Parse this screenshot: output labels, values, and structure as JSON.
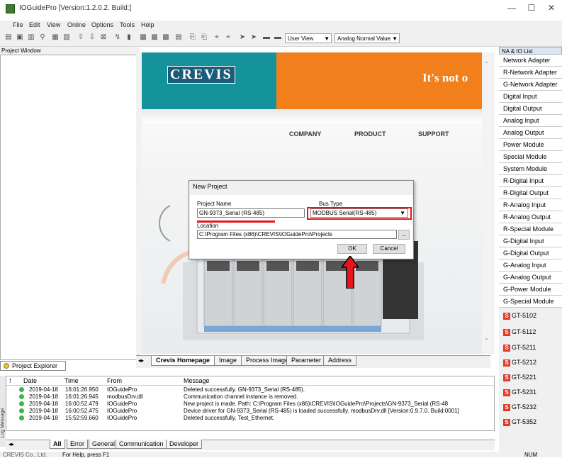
{
  "window": {
    "title": "IOGuidePro  [Version:1.2.0.2. Build:]",
    "minimize": "—",
    "maximize": "☐",
    "close": "✕"
  },
  "menu": [
    "File",
    "Edit",
    "View",
    "Online",
    "Options",
    "Tools",
    "Help"
  ],
  "toolbar": {
    "view_select": "User View",
    "value_select": "Analog Normal Value"
  },
  "project_window": {
    "title": "Project Window",
    "explorer_tab": "Project Explorer"
  },
  "homepage": {
    "logo": "CREVIS",
    "slogan": "It's not o",
    "nav": [
      "COMPANY",
      "PRODUCT",
      "SUPPORT"
    ]
  },
  "view_tabs": [
    "Crevis Homepage",
    "Image",
    "Process Image",
    "Parameter",
    "Address"
  ],
  "right_panel": {
    "title": "NA & IO List",
    "categories": [
      "Network Adapter",
      "R-Network Adapter",
      "G-Network Adapter",
      "Digital Input",
      "Digital Output",
      "Analog Input",
      "Analog Output",
      "Power Module",
      "Special Module",
      "System Module",
      "R-Digital Input",
      "R-Digital Output",
      "R-Analog Input",
      "R-Analog Output",
      "R-Special Module",
      "G-Digital Input",
      "G-Digital Output",
      "G-Analog Input",
      "G-Analog Output",
      "G-Power Module",
      "G-Special Module"
    ],
    "modules": [
      "GT-5102",
      "GT-5112",
      "GT-5211",
      "GT-5212",
      "GT-5221",
      "GT-5231",
      "GT-5232",
      "GT-5352"
    ]
  },
  "dialog": {
    "title": "New Project",
    "project_name_label": "Project Name",
    "project_name_value": "GN-9373_Serial (RS-485)",
    "bus_type_label": "Bus Type",
    "bus_type_value": "MODBUS Serial(RS-485)",
    "location_label": "Location",
    "location_value": "C:\\Program Files (x86)\\CREVIS\\IOGuidePro\\Projects",
    "browse": "...",
    "ok": "OK",
    "cancel": "Cancel"
  },
  "log": {
    "side_label": "Log Message",
    "headers": {
      "index": "!",
      "date": "Date",
      "time": "Time",
      "from": "From",
      "message": "Message"
    },
    "rows": [
      {
        "date": "2019-04-18",
        "time": "16:01:26.950",
        "from": "IOGuidePro",
        "message": "Deleted successfully. GN-9373_Serial (RS-485)."
      },
      {
        "date": "2019-04-18",
        "time": "16:01:26.945",
        "from": "modbusDrv.dll",
        "message": "Communication channel instance is removed."
      },
      {
        "date": "2019-04-18",
        "time": "16:00:52.479",
        "from": "IOGuidePro",
        "message": "New project is made. Path: C:\\Program Files (x86)\\CREVIS\\IOGuidePro\\Projects\\GN-9373_Serial (RS-48"
      },
      {
        "date": "2019-04-18",
        "time": "16:00:52.475",
        "from": "IOGuidePro",
        "message": "Device driver for GN-9373_Serial (RS-485) is loaded successfully. modbusDrv.dll [Version:0.9.7.0. Build:0001]"
      },
      {
        "date": "2019-04-18",
        "time": "15:52:59.660",
        "from": "IOGuidePro",
        "message": "Deleted successfully. Test_Ethernet."
      }
    ],
    "tabs": [
      "All",
      "Error",
      "General",
      "Communication",
      "Developer"
    ]
  },
  "status": {
    "left": "CREVIS Co., Ltd.",
    "help": "For Help, press F1",
    "num": "NUM"
  }
}
